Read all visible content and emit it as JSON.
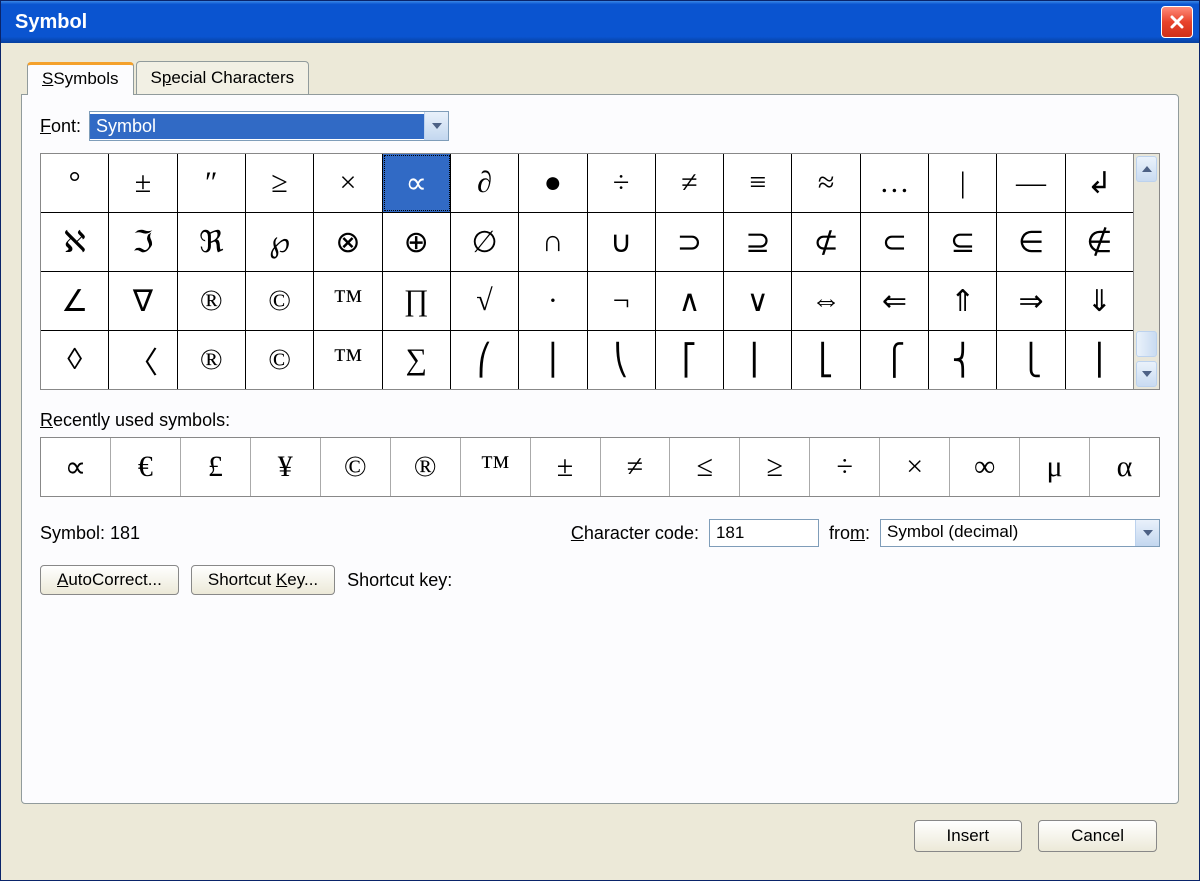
{
  "title": "Symbol",
  "close": "X",
  "tabs": {
    "symbols": "Symbols",
    "special": "Special Characters"
  },
  "font": {
    "label": "Font:",
    "value": "Symbol"
  },
  "grid": [
    [
      "°",
      "±",
      "″",
      "≥",
      "×",
      "∝",
      "∂",
      "●",
      "÷",
      "≠",
      "≡",
      "≈",
      "…",
      "|",
      "—",
      "↲"
    ],
    [
      "ℵ",
      "ℑ",
      "ℜ",
      "℘",
      "⊗",
      "⊕",
      "∅",
      "∩",
      "∪",
      "⊃",
      "⊇",
      "⊄",
      "⊂",
      "⊆",
      "∈",
      "∉"
    ],
    [
      "∠",
      "∇",
      "®",
      "©",
      "™",
      "∏",
      "√",
      "·",
      "¬",
      "∧",
      "∨",
      "⇔",
      "⇐",
      "⇑",
      "⇒",
      "⇓"
    ],
    [
      "◊",
      "〈",
      "®",
      "©",
      "™",
      "∑",
      "⎛",
      "⎪",
      "⎝",
      "⎡",
      "⎢",
      "⎣",
      "⎧",
      "⎨",
      "⎩",
      "⎪"
    ]
  ],
  "selected_row": 0,
  "selected_col": 5,
  "recent_label": "Recently used symbols:",
  "recent": [
    "∝",
    "€",
    "£",
    "¥",
    "©",
    "®",
    "™",
    "±",
    "≠",
    "≤",
    "≥",
    "÷",
    "×",
    "∞",
    "μ",
    "α"
  ],
  "symbol_name_label": "Symbol: 181",
  "char_code_label": "Character code:",
  "char_code": "181",
  "from_label": "from:",
  "from_value": "Symbol (decimal)",
  "autocorrect_btn": "AutoCorrect...",
  "shortcut_key_btn": "Shortcut Key...",
  "shortcut_key_label": "Shortcut key:",
  "insert": "Insert",
  "cancel": "Cancel"
}
